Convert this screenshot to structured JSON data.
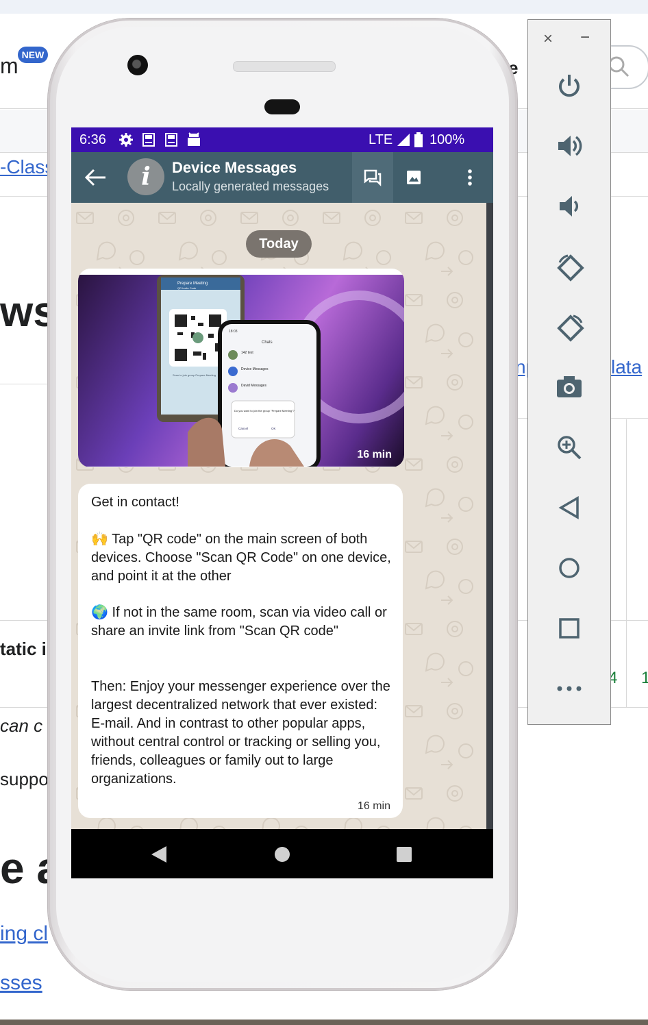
{
  "background_page": {
    "new_badge": "NEW",
    "fragments": {
      "m": "m",
      "e": "e",
      "class_link": "-Class",
      "ws": "ws",
      "data_link": "lata",
      "np_link": "np",
      "tatic": "tatic i",
      "can_c": "can c",
      "suppo": "suppo",
      "e_al": "e al",
      "ing_c": "ing cl",
      "sses": "sses",
      "num_4": "4",
      "num_1": "1"
    }
  },
  "status_bar": {
    "time": "6:36",
    "network": "LTE",
    "battery": "100%"
  },
  "app_bar": {
    "title": "Device Messages",
    "subtitle": "Locally generated messages",
    "avatar_letter": "i"
  },
  "chat": {
    "date_separator": "Today",
    "messages": [
      {
        "type": "image",
        "time": "16 min",
        "image_texts": {
          "meeting_title": "Prepare Meeting",
          "qr_label": "QR Invite Code",
          "scan_caption": "Scan to join group Prepare Meeting",
          "phone_header": "Chats",
          "phone_time": "18:03",
          "chat1": "142 test",
          "chat2": "Device Messages",
          "chat3": "David Messages",
          "dialog_text": "Do you want to join the group \"Prepare Meeting\"?",
          "dialog_cancel": "Cancel",
          "dialog_ok": "OK"
        }
      },
      {
        "type": "text",
        "paragraphs": [
          "Get in contact!",
          "🙌 Tap \"QR code\" on the main screen of both devices. Choose \"Scan QR Code\" on one device, and point it at the other",
          "🌍 If not in the same room, scan via video call or share an invite link from \"Scan QR code\"",
          "Then: Enjoy your messenger experience over the largest decentralized network that ever existed: E-mail. And in contrast to other popular apps, without central control or tracking or selling you, friends, colleagues or family out to large organizations."
        ],
        "time": "16 min"
      }
    ]
  },
  "emulator_toolbar": {
    "close": "×",
    "minimize": "−",
    "buttons": [
      "power-icon",
      "volume-up-icon",
      "volume-down-icon",
      "rotate-left-icon",
      "rotate-right-icon",
      "camera-icon",
      "zoom-icon",
      "back-icon",
      "home-icon",
      "overview-icon",
      "more-icon"
    ]
  },
  "colors": {
    "status_bar": "#3a0fb0",
    "app_bar": "#415e6b",
    "chat_background": "#e7e0d6",
    "link": "#3366cc"
  }
}
